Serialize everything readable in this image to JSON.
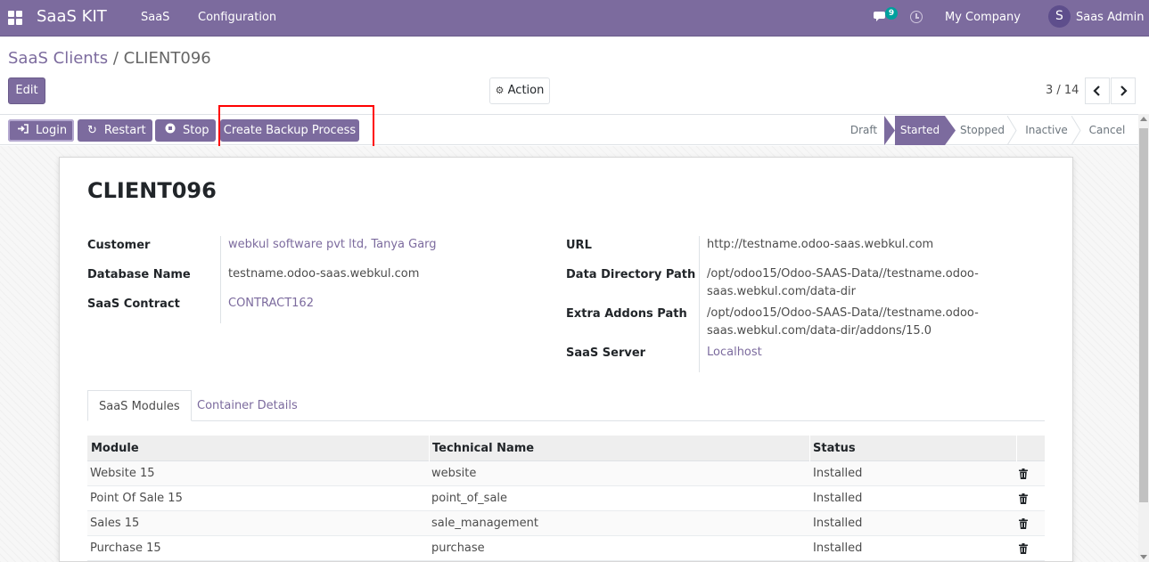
{
  "navbar": {
    "brand": "SaaS KIT",
    "menus": [
      "SaaS",
      "Configuration"
    ],
    "chat_count": "9",
    "company": "My Company",
    "avatar_initial": "S",
    "user": "Saas Admin"
  },
  "breadcrumb": {
    "parent": "SaaS Clients",
    "separator": " / ",
    "current": "CLIENT096"
  },
  "control": {
    "edit_label": "Edit",
    "action_label": "Action",
    "pager": "3 / 14"
  },
  "statusbar": {
    "buttons": {
      "login": "Login",
      "restart": "Restart",
      "stop": "Stop",
      "backup": "Create Backup Process"
    },
    "stages": [
      "Draft",
      "Started",
      "Stopped",
      "Inactive",
      "Cancel"
    ],
    "active_stage": "Started"
  },
  "form": {
    "title": "CLIENT096",
    "left": {
      "customer_label": "Customer",
      "customer_value": "webkul software pvt ltd, Tanya Garg",
      "db_label": "Database Name",
      "db_value": "testname.odoo-saas.webkul.com",
      "contract_label": "SaaS Contract",
      "contract_value": "CONTRACT162"
    },
    "right": {
      "url_label": "URL",
      "url_value": "http://testname.odoo-saas.webkul.com",
      "datadir_label": "Data Directory Path",
      "datadir_value_1": "/opt/odoo15/Odoo-SAAS-Data//testname.odoo-",
      "datadir_value_2": "saas.webkul.com/data-dir",
      "addons_label": "Extra Addons Path",
      "addons_value_1": "/opt/odoo15/Odoo-SAAS-Data//testname.odoo-",
      "addons_value_2": "saas.webkul.com/data-dir/addons/15.0",
      "server_label": "SaaS Server",
      "server_value": "Localhost"
    }
  },
  "tabs": [
    "SaaS Modules",
    "Container Details"
  ],
  "table": {
    "headers": [
      "Module",
      "Technical Name",
      "Status"
    ],
    "rows": [
      {
        "module": "Website 15",
        "technical": "website",
        "status": "Installed"
      },
      {
        "module": "Point Of Sale 15",
        "technical": "point_of_sale",
        "status": "Installed"
      },
      {
        "module": "Sales 15",
        "technical": "sale_management",
        "status": "Installed"
      },
      {
        "module": "Purchase 15",
        "technical": "purchase",
        "status": "Installed"
      }
    ]
  },
  "colors": {
    "primary": "#7c6b9e",
    "highlight": "#ff0000",
    "badge": "#00a09d"
  }
}
